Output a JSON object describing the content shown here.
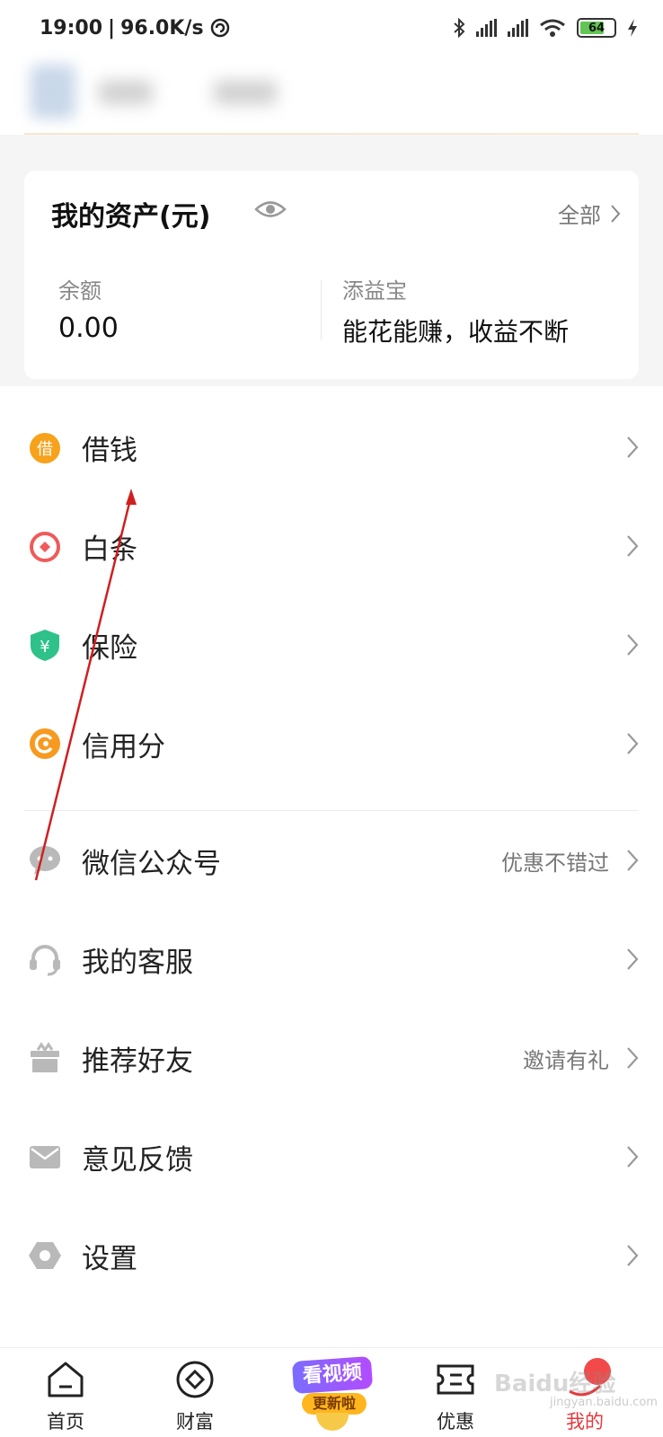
{
  "status_bar": {
    "time": "19:00",
    "net_speed": "96.0K/s",
    "battery_level": "64"
  },
  "assets": {
    "title": "我的资产(元)",
    "all_label": "全部",
    "balance_label": "余额",
    "balance_value": "0.00",
    "fund_label": "添益宝",
    "fund_desc": "能花能赚，收益不断"
  },
  "menu": [
    {
      "label": "借钱",
      "aux": "",
      "icon": "borrow-icon"
    },
    {
      "label": "白条",
      "aux": "",
      "icon": "baitiao-icon"
    },
    {
      "label": "保险",
      "aux": "",
      "icon": "insurance-shield-icon"
    },
    {
      "label": "信用分",
      "aux": "",
      "icon": "credit-score-icon"
    },
    {
      "label": "微信公众号",
      "aux": "优惠不错过",
      "icon": "wechat-icon"
    },
    {
      "label": "我的客服",
      "aux": "",
      "icon": "headset-icon"
    },
    {
      "label": "推荐好友",
      "aux": "邀请有礼",
      "icon": "gift-icon"
    },
    {
      "label": "意见反馈",
      "aux": "",
      "icon": "mail-icon"
    },
    {
      "label": "设置",
      "aux": "",
      "icon": "settings-icon"
    }
  ],
  "borrow_icon_text": "借",
  "insurance_icon_text": "¥",
  "tabbar": {
    "home": "首页",
    "wealth": "财富",
    "promo_top": "看视频",
    "promo_bottom": "更新啦",
    "offers": "优惠",
    "mine": "我的"
  },
  "watermark": {
    "brand": "Baidu经验",
    "url": "jingyan.baidu.com"
  },
  "colors": {
    "accent": "#e4393c",
    "borrow": "#f7a21b",
    "baitiao": "#f05a5a",
    "insurance": "#2ec28a",
    "credit": "#f79a1f",
    "grey_icon": "#b9b9b9"
  }
}
